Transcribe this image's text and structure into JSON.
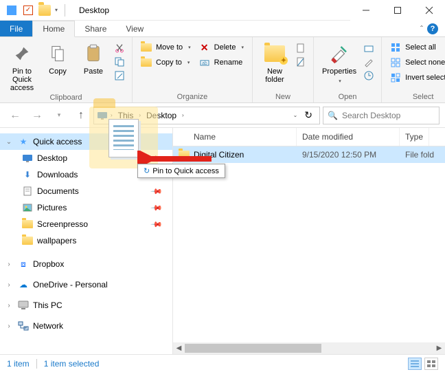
{
  "window": {
    "title": "Desktop"
  },
  "tabs": {
    "file": "File",
    "home": "Home",
    "share": "Share",
    "view": "View"
  },
  "ribbon": {
    "clipboard": {
      "label": "Clipboard",
      "pin": "Pin to Quick access",
      "copy": "Copy",
      "paste": "Paste"
    },
    "organize": {
      "label": "Organize",
      "moveto": "Move to",
      "copyto": "Copy to",
      "delete": "Delete",
      "rename": "Rename"
    },
    "new": {
      "label": "New",
      "newfolder": "New folder"
    },
    "open": {
      "label": "Open",
      "properties": "Properties"
    },
    "select": {
      "label": "Select",
      "all": "Select all",
      "none": "Select none",
      "invert": "Invert selection"
    }
  },
  "address": {
    "seg1": "This",
    "seg2": "Desktop"
  },
  "search": {
    "placeholder": "Search Desktop"
  },
  "columns": {
    "name": "Name",
    "date": "Date modified",
    "type": "Type"
  },
  "files": [
    {
      "name": "Digital Citizen",
      "date": "9/15/2020 12:50 PM",
      "type": "File fold"
    }
  ],
  "nav": {
    "quick_access": "Quick access",
    "items": [
      {
        "label": "Desktop",
        "pinned": true,
        "icon": "desktop"
      },
      {
        "label": "Downloads",
        "pinned": true,
        "icon": "downloads"
      },
      {
        "label": "Documents",
        "pinned": true,
        "icon": "documents"
      },
      {
        "label": "Pictures",
        "pinned": true,
        "icon": "pictures"
      },
      {
        "label": "Screenpresso",
        "pinned": true,
        "icon": "folder"
      },
      {
        "label": "wallpapers",
        "pinned": false,
        "icon": "folder"
      }
    ],
    "roots": [
      {
        "label": "Dropbox",
        "icon": "dropbox"
      },
      {
        "label": "OneDrive - Personal",
        "icon": "onedrive"
      },
      {
        "label": "This PC",
        "icon": "thispc"
      },
      {
        "label": "Network",
        "icon": "network"
      }
    ]
  },
  "drag_tip": "Pin to Quick access",
  "status": {
    "count": "1 item",
    "selected": "1 item selected"
  }
}
